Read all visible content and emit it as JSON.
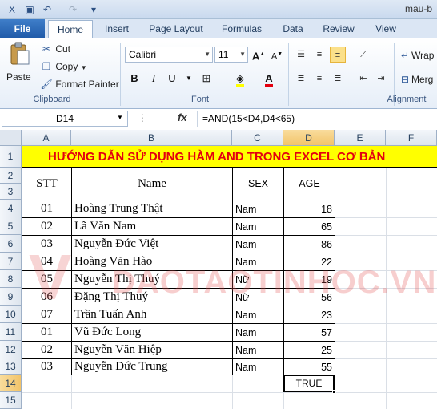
{
  "window": {
    "title": "mau-b"
  },
  "ribbon_tabs": [
    "File",
    "Home",
    "Insert",
    "Page Layout",
    "Formulas",
    "Data",
    "Review",
    "View"
  ],
  "clipboard": {
    "paste": "Paste",
    "cut": "Cut",
    "copy": "Copy",
    "format_painter": "Format Painter",
    "label": "Clipboard"
  },
  "font": {
    "name": "Calibri",
    "size": "11",
    "bold": "B",
    "italic": "I",
    "underline": "U",
    "label": "Font"
  },
  "alignment": {
    "wrap": "Wrap",
    "merge": "Merg",
    "label": "Alignment"
  },
  "formula_bar": {
    "name_box": "D14",
    "fx": "fx",
    "formula": "=AND(15<D4,D4<65)"
  },
  "columns": [
    "A",
    "B",
    "C",
    "D",
    "E",
    "F"
  ],
  "rows": [
    "1",
    "2",
    "3",
    "4",
    "5",
    "6",
    "7",
    "8",
    "9",
    "10",
    "11",
    "12",
    "13",
    "14",
    "15"
  ],
  "sheet": {
    "title": "HƯỚNG DẪN SỬ DỤNG HÀM AND TRONG EXCEL CƠ BẢN",
    "headers": {
      "stt": "STT",
      "name": "Name",
      "sex": "SEX",
      "age": "AGE"
    },
    "records": [
      {
        "stt": "01",
        "name": "Hoàng Trung Thật",
        "sex": "Nam",
        "age": "18"
      },
      {
        "stt": "02",
        "name": "Lã Văn Nam",
        "sex": "Nam",
        "age": "65"
      },
      {
        "stt": "03",
        "name": "Nguyễn Đức Việt",
        "sex": "Nam",
        "age": "86"
      },
      {
        "stt": "04",
        "name": "Hoàng Văn Hào",
        "sex": "Nam",
        "age": "22"
      },
      {
        "stt": "05",
        "name": "Nguyễn Thị Thuý",
        "sex": "Nữ",
        "age": "19"
      },
      {
        "stt": "06",
        "name": "Đặng Thị Thuý",
        "sex": "Nữ",
        "age": "56"
      },
      {
        "stt": "07",
        "name": "Trần Tuấn Anh",
        "sex": "Nam",
        "age": "23"
      },
      {
        "stt": "01",
        "name": "Vũ Đức Long",
        "sex": "Nam",
        "age": "57"
      },
      {
        "stt": "02",
        "name": "Nguyễn Văn Hiệp",
        "sex": "Nam",
        "age": "25"
      },
      {
        "stt": "03",
        "name": "Nguyễn Đức Trung",
        "sex": "Nam",
        "age": "55"
      }
    ],
    "result": "TRUE"
  },
  "watermark": "DAOTAOTINHOC.VN",
  "colors": {
    "title_fill": "#ffff00",
    "title_text": "#e3000f",
    "selection": "#f2c46a"
  }
}
